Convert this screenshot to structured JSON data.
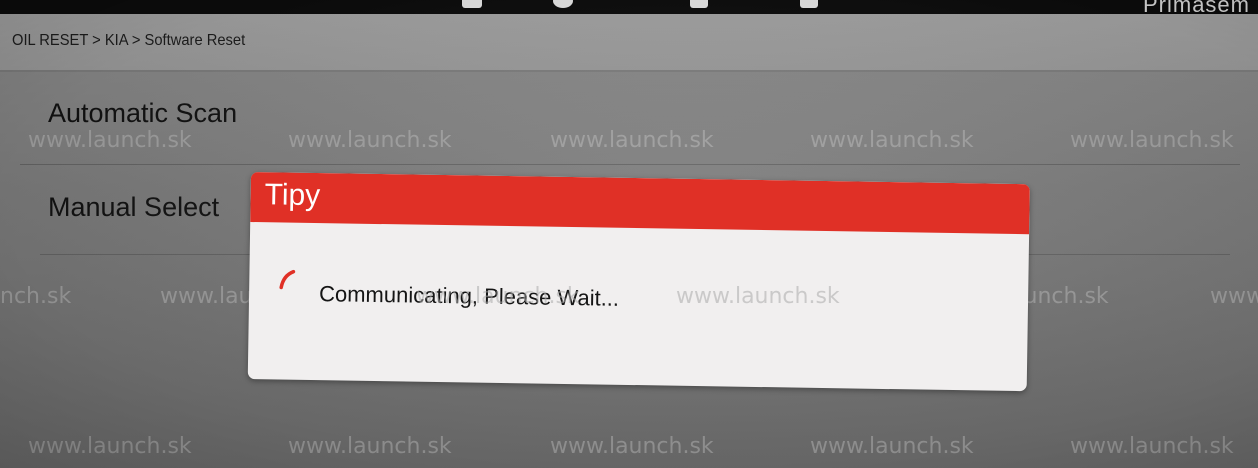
{
  "breadcrumb": "OIL RESET > KIA > Software Reset",
  "brand_fragment": "Primasem",
  "menu": {
    "items": [
      {
        "label": "Automatic Scan"
      },
      {
        "label": "Manual Select"
      }
    ]
  },
  "dialog": {
    "title": "Tipy",
    "message": "Communicating, Please Wait..."
  },
  "watermark_text": "www.launch.sk",
  "watermark_fragment_left": "nch.sk",
  "watermark_fragment_right": "www",
  "colors": {
    "dialog_header": "#e03026",
    "dialog_body": "#f1efef",
    "background": "#8a8a8a",
    "spinner": "#e03026"
  },
  "icons": {
    "spinner": "loading-spinner-icon"
  }
}
